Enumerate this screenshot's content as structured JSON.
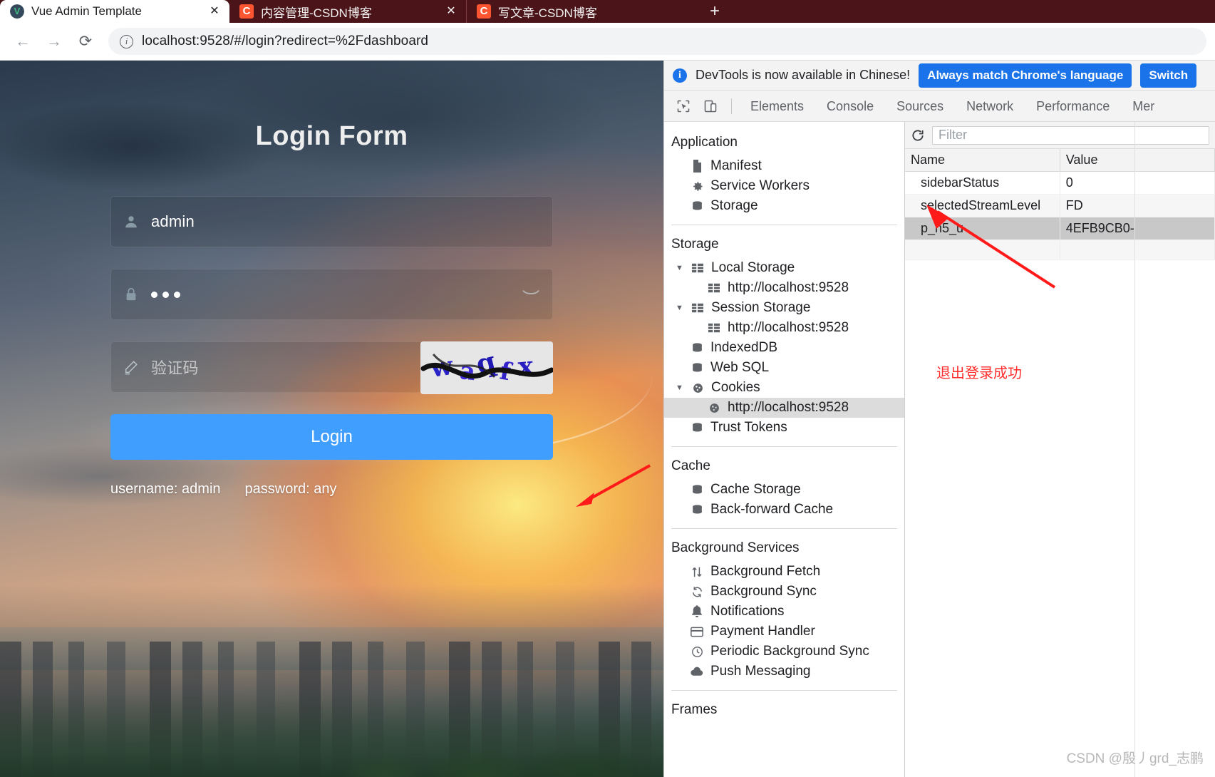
{
  "browser": {
    "tabs": [
      {
        "title": "Vue Admin Template",
        "favicon": "vue-icon",
        "active": true,
        "close_label": "✕"
      },
      {
        "title": "内容管理-CSDN博客",
        "favicon": "csdn-icon",
        "active": false,
        "close_label": "✕"
      },
      {
        "title": "写文章-CSDN博客",
        "favicon": "csdn-icon",
        "active": false,
        "close_label": ""
      }
    ],
    "new_tab_label": "+",
    "back_label": "←",
    "forward_label": "→",
    "reload_label": "⟳",
    "site_info_label": "i",
    "url": "localhost:9528/#/login?redirect=%2Fdashboard"
  },
  "login": {
    "title": "Login Form",
    "username": {
      "value": "admin",
      "icon": "user-icon"
    },
    "password": {
      "value": "•••",
      "icon": "lock-icon",
      "eye_icon": "eye-off-icon"
    },
    "captcha": {
      "placeholder": "验证码",
      "icon": "pencil-icon",
      "image_text": "waqfx"
    },
    "submit_label": "Login",
    "tips": [
      "username: admin",
      "password: any"
    ]
  },
  "devtools": {
    "banner": {
      "message": "DevTools is now available in Chinese!",
      "primary_button": "Always match Chrome's language",
      "secondary_button": "Switch"
    },
    "toolbar_icons": [
      "inspect-icon",
      "device-toolbar-icon"
    ],
    "tabs": [
      "Elements",
      "Console",
      "Sources",
      "Network",
      "Performance",
      "Mer"
    ],
    "tree": {
      "sections": [
        {
          "title": "Application",
          "items": [
            {
              "label": "Manifest",
              "icon": "document-icon",
              "indent": 1
            },
            {
              "label": "Service Workers",
              "icon": "gear-icon",
              "indent": 1
            },
            {
              "label": "Storage",
              "icon": "database-icon",
              "indent": 1
            }
          ]
        },
        {
          "title": "Storage",
          "items": [
            {
              "label": "Local Storage",
              "icon": "table-icon",
              "indent": 1,
              "twisty": "▼"
            },
            {
              "label": "http://localhost:9528",
              "icon": "table-icon",
              "indent": 2
            },
            {
              "label": "Session Storage",
              "icon": "table-icon",
              "indent": 1,
              "twisty": "▼"
            },
            {
              "label": "http://localhost:9528",
              "icon": "table-icon",
              "indent": 2
            },
            {
              "label": "IndexedDB",
              "icon": "database-icon",
              "indent": 1
            },
            {
              "label": "Web SQL",
              "icon": "database-icon",
              "indent": 1
            },
            {
              "label": "Cookies",
              "icon": "cookie-icon",
              "indent": 1,
              "twisty": "▼"
            },
            {
              "label": "http://localhost:9528",
              "icon": "cookie-icon",
              "indent": 2,
              "selected": true
            },
            {
              "label": "Trust Tokens",
              "icon": "database-icon",
              "indent": 1
            }
          ]
        },
        {
          "title": "Cache",
          "items": [
            {
              "label": "Cache Storage",
              "icon": "database-icon",
              "indent": 1
            },
            {
              "label": "Back-forward Cache",
              "icon": "database-icon",
              "indent": 1
            }
          ]
        },
        {
          "title": "Background Services",
          "items": [
            {
              "label": "Background Fetch",
              "icon": "updown-arrows-icon",
              "indent": 1
            },
            {
              "label": "Background Sync",
              "icon": "sync-icon",
              "indent": 1
            },
            {
              "label": "Notifications",
              "icon": "bell-icon",
              "indent": 1
            },
            {
              "label": "Payment Handler",
              "icon": "credit-card-icon",
              "indent": 1
            },
            {
              "label": "Periodic Background Sync",
              "icon": "clock-icon",
              "indent": 1
            },
            {
              "label": "Push Messaging",
              "icon": "cloud-icon",
              "indent": 1
            }
          ]
        },
        {
          "title": "Frames",
          "items": []
        }
      ]
    },
    "cookies_panel": {
      "refresh_label": "refresh-icon",
      "filter_placeholder": "Filter",
      "columns": [
        "Name",
        "Value"
      ],
      "rows": [
        {
          "name": "sidebarStatus",
          "value": "0"
        },
        {
          "name": "selectedStreamLevel",
          "value": "FD"
        },
        {
          "name": "p_h5_u",
          "value": "4EFB9CB0-",
          "selected": true
        }
      ],
      "note": "退出登录成功"
    },
    "watermark": "CSDN @殷丿grd_志鹏"
  },
  "colors": {
    "accent_blue": "#409eff",
    "devtools_blue": "#1a73e8",
    "tabstrip": "#4b1418",
    "annotation_red": "#ff2d2d",
    "csdn_orange": "#fc5531"
  }
}
